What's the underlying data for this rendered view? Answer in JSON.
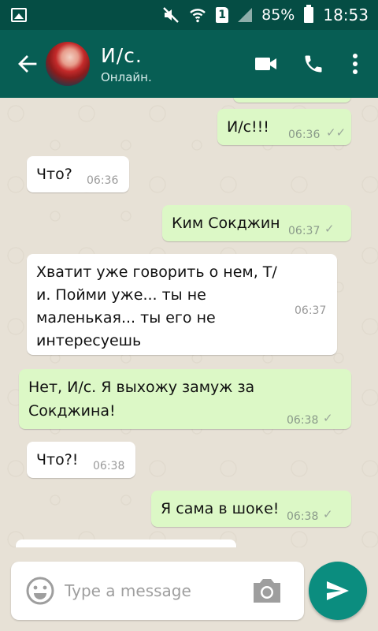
{
  "status_bar": {
    "battery": "85%",
    "time": "18:53",
    "sim_slot": "1",
    "icons": [
      "gallery-icon",
      "mute-icon",
      "wifi-icon",
      "sim-icon",
      "signal-icon",
      "battery-icon"
    ]
  },
  "header": {
    "name": "И/с.",
    "status": "Онлайн.",
    "icons": [
      "back-arrow-icon",
      "avatar",
      "video-call-icon",
      "voice-call-icon",
      "more-options-icon"
    ]
  },
  "messages": [
    {
      "direction": "out",
      "text": "И/с!!!",
      "time": "06:36",
      "status": "read"
    },
    {
      "direction": "in",
      "text": "Что?",
      "time": "06:36"
    },
    {
      "direction": "out",
      "text": "Ким Сокджин",
      "time": "06:37",
      "status": "sent"
    },
    {
      "direction": "in",
      "lines": [
        "Хватит уже говорить о нем, Т/",
        "и. Пойми уже... ты не",
        "маленькая... ты его не",
        "интересуешь"
      ],
      "time": "06:37"
    },
    {
      "direction": "out",
      "lines": [
        "Нет, И/с. Я выхожу замуж за",
        "Сокджина!"
      ],
      "time": "06:38",
      "status": "sent"
    },
    {
      "direction": "in",
      "text": "Что?!",
      "time": "06:38"
    },
    {
      "direction": "out",
      "text": "Я сама в шоке!",
      "time": "06:38",
      "status": "sent"
    }
  ],
  "composer": {
    "placeholder": "Type a message",
    "icons": [
      "emoji-icon",
      "camera-icon",
      "send-icon"
    ]
  },
  "colors": {
    "status_bar": "#054d44",
    "header": "#075e54",
    "outgoing_bubble": "#dcf8c6",
    "incoming_bubble": "#ffffff",
    "send_button": "#0b8d7f",
    "background": "#e7e1d6"
  }
}
